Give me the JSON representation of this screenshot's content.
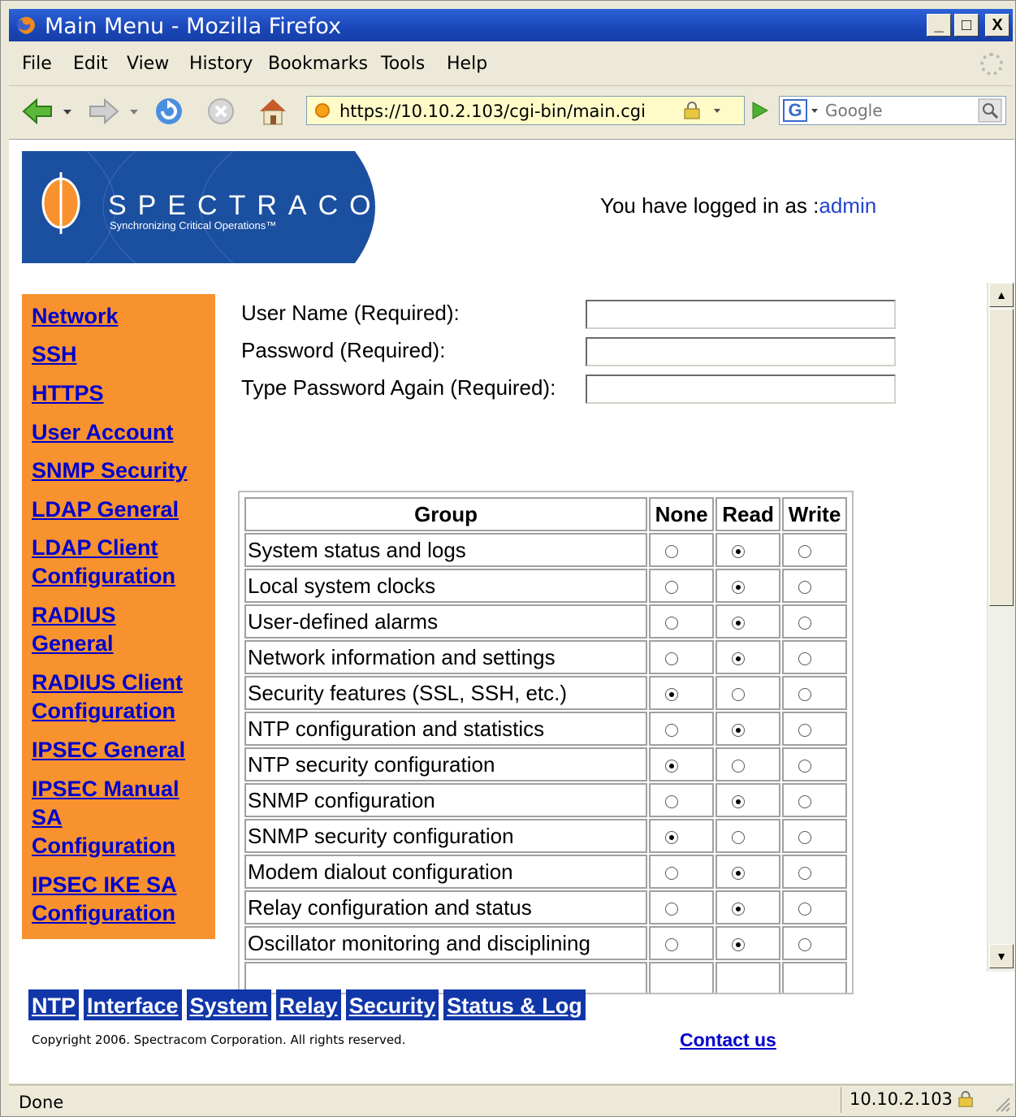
{
  "window": {
    "title": "Main Menu - Mozilla Firefox",
    "minimize": "_",
    "maximize": "□",
    "close": "X"
  },
  "menu": [
    "File",
    "Edit",
    "View",
    "History",
    "Bookmarks",
    "Tools",
    "Help"
  ],
  "toolbar": {
    "url": "https://10.10.2.103/cgi-bin/main.cgi",
    "search_engine": "G",
    "search_placeholder": "Google"
  },
  "header": {
    "logo_text": "SPECTRACOM",
    "logo_tagline": "Synchronizing Critical Operations™",
    "logged_in_prefix": "You have logged in as :",
    "logged_in_user": "admin"
  },
  "sidebar": {
    "links": [
      "Network",
      "SSH",
      "HTTPS",
      "User Account",
      "SNMP Security",
      "LDAP General",
      "LDAP Client Configuration",
      "RADIUS General",
      "RADIUS Client Configuration",
      "IPSEC General",
      "IPSEC Manual SA Configuration",
      "IPSEC IKE SA Configuration"
    ]
  },
  "form": {
    "username_label": "User Name (Required):",
    "password_label": "Password (Required):",
    "password_again_label": "Type Password Again (Required):",
    "username_value": "",
    "password_value": "",
    "password_again_value": ""
  },
  "permissions": {
    "headers": [
      "Group",
      "None",
      "Read",
      "Write"
    ],
    "rows": [
      {
        "group": "System status and logs",
        "selected": "Read"
      },
      {
        "group": "Local system clocks",
        "selected": "Read"
      },
      {
        "group": "User-defined alarms",
        "selected": "Read"
      },
      {
        "group": "Network information and settings",
        "selected": "Read"
      },
      {
        "group": "Security features (SSL, SSH, etc.)",
        "selected": "None"
      },
      {
        "group": "NTP configuration and statistics",
        "selected": "Read"
      },
      {
        "group": "NTP security configuration",
        "selected": "None"
      },
      {
        "group": "SNMP configuration",
        "selected": "Read"
      },
      {
        "group": "SNMP security configuration",
        "selected": "None"
      },
      {
        "group": "Modem dialout configuration",
        "selected": "Read"
      },
      {
        "group": "Relay configuration and status",
        "selected": "Read"
      },
      {
        "group": "Oscillator monitoring and disciplining",
        "selected": "Read"
      },
      {
        "group": "",
        "selected": ""
      }
    ]
  },
  "bottom_nav": [
    "NTP",
    "Interface",
    "System",
    "Relay",
    "Security",
    "Status & Log"
  ],
  "footer": {
    "copyright": "Copyright 2006. Spectracom Corporation. All rights reserved.",
    "contact": "Contact us"
  },
  "statusbar": {
    "status": "Done",
    "host": "10.10.2.103"
  },
  "colors": {
    "sidebar_bg": "#f7922f",
    "nav_bg": "#1136a8",
    "link": "#0000cc",
    "logo_bg": "#1b4fa0"
  }
}
